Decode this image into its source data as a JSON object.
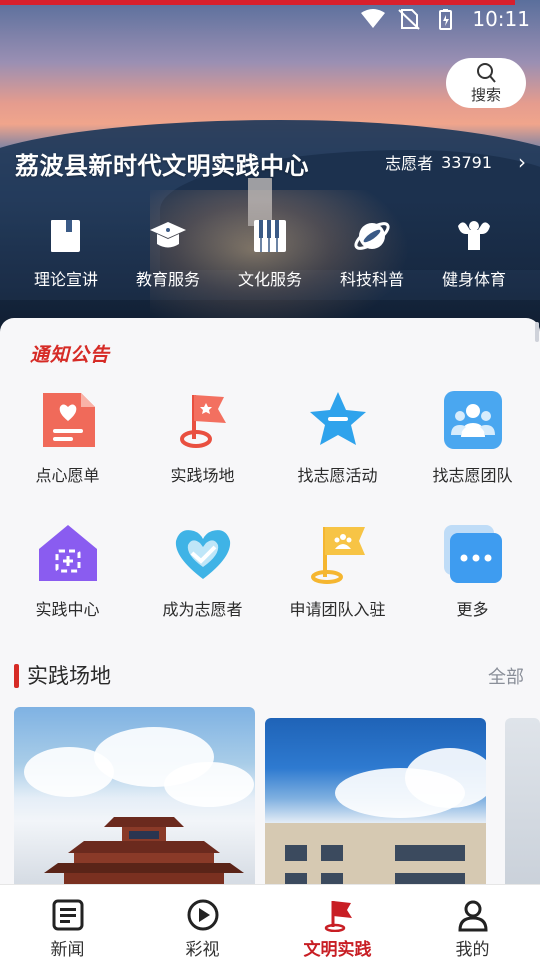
{
  "status_bar": {
    "time": "10:11"
  },
  "header": {
    "title": "荔波县新时代文明实践中心",
    "search_label": "搜索",
    "volunteer_label": "志愿者",
    "volunteer_count": "33791"
  },
  "categories": [
    {
      "label": "理论宣讲",
      "icon": "book-icon"
    },
    {
      "label": "教育服务",
      "icon": "graduation-cap-icon"
    },
    {
      "label": "文化服务",
      "icon": "piano-icon"
    },
    {
      "label": "科技科普",
      "icon": "planet-icon"
    },
    {
      "label": "健身体育",
      "icon": "muscle-icon"
    }
  ],
  "notice_label": "通知公告",
  "grid": [
    {
      "label": "点心愿单",
      "icon": "wish-list-icon"
    },
    {
      "label": "实践场地",
      "icon": "flag-pin-icon"
    },
    {
      "label": "找志愿活动",
      "icon": "star-icon"
    },
    {
      "label": "找志愿团队",
      "icon": "team-icon"
    },
    {
      "label": "实践中心",
      "icon": "house-icon"
    },
    {
      "label": "成为志愿者",
      "icon": "heart-icon"
    },
    {
      "label": "申请团队入驻",
      "icon": "team-flag-icon"
    },
    {
      "label": "更多",
      "icon": "more-icon"
    }
  ],
  "section": {
    "title": "实践场地",
    "more_label": "全部"
  },
  "tabs": [
    {
      "label": "新闻",
      "icon": "news-icon",
      "active": false
    },
    {
      "label": "彩视",
      "icon": "play-icon",
      "active": false
    },
    {
      "label": "文明实践",
      "icon": "flag-icon",
      "active": true
    },
    {
      "label": "我的",
      "icon": "user-icon",
      "active": false
    }
  ],
  "colors": {
    "accent": "#c81e24",
    "notice": "#d62b26"
  }
}
